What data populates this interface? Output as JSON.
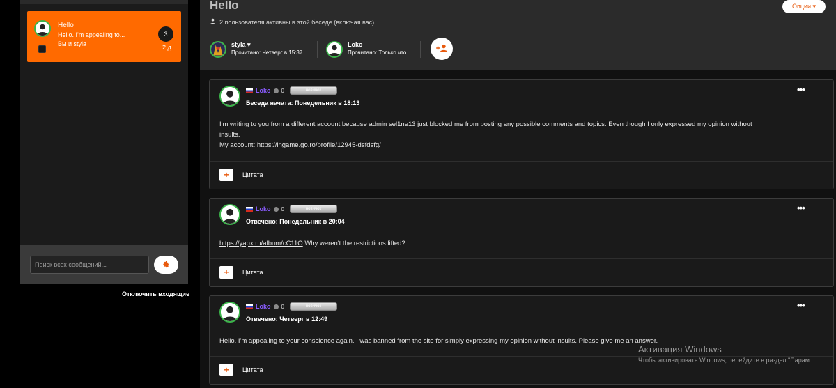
{
  "sidebar": {
    "conversation": {
      "title": "Hello",
      "snippet": "Hello. I'm appealing to...",
      "members": "Вы и styla",
      "unread_count": "3",
      "age": "2 д."
    },
    "search": {
      "placeholder": "Поиск всех сообщений..."
    },
    "disable_incoming": "Отключить входящие"
  },
  "header": {
    "title": "Hello",
    "options_label": "Опции ▾",
    "active_text": "2 пользователя активны в этой беседе (включая вас)",
    "participants": [
      {
        "name": "styla ▾",
        "read": "Прочитано: Четверг в 15:37"
      },
      {
        "name": "Loko",
        "read": "Прочитано: Только что"
      }
    ]
  },
  "messages": [
    {
      "user": "Loko",
      "count": "0",
      "rank": "новичок",
      "meta": "Беседа начата: Понедельник в 18:13",
      "line1": "I'm writing to you from a different account because admin sel1ne13 just blocked me from posting any possible comments and topics. Even though I only expressed my opinion without",
      "line2": "insults.",
      "line3_prefix": "My account: ",
      "line3_link": "https://ingame.go.ro/profile/12945-dsfdsfg/",
      "quote": "Цитата"
    },
    {
      "user": "Loko",
      "count": "0",
      "rank": "новичок",
      "meta": "Отвечено: Понедельник в 20:04",
      "link": "https://yapx.ru/album/cC11O",
      "text": " Why weren't the restrictions lifted?",
      "quote": "Цитата"
    },
    {
      "user": "Loko",
      "count": "0",
      "rank": "новичок",
      "meta": "Отвечено: Четверг в 12:49",
      "text": "Hello. I'm appealing to your conscience again. I was banned from the site for simply expressing my opinion without insults. Please give me an answer.",
      "quote": "Цитата"
    }
  ],
  "watermark": {
    "title": "Активация Windows",
    "subtitle": "Чтобы активировать Windows, перейдите в раздел \"Парам"
  },
  "colors": {
    "accent": "#ff6a00",
    "username": "#8a5cff",
    "avatar_ring": "#3bb54a"
  }
}
